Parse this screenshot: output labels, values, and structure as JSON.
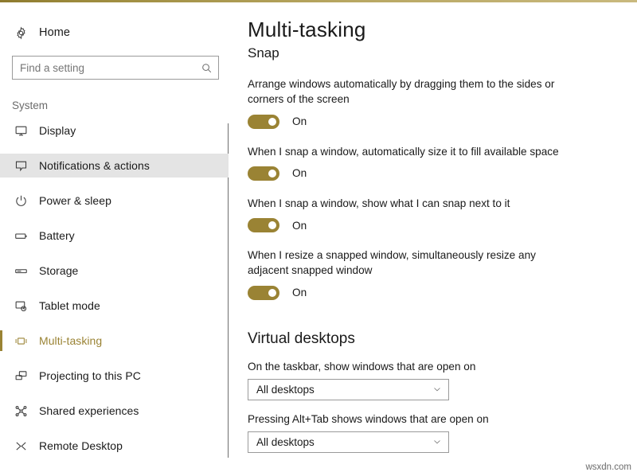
{
  "theme": {
    "accent": "#9a8334",
    "highlight": "#e4e4e4",
    "text": "#1a1a1a",
    "muted": "#6b6b6b"
  },
  "sidebar": {
    "home": {
      "label": "Home",
      "icon": "gear-icon"
    },
    "search": {
      "placeholder": "Find a setting",
      "value": "",
      "icon": "search-icon"
    },
    "section_label": "System",
    "items": [
      {
        "label": "Display",
        "icon": "monitor-icon",
        "state": "normal"
      },
      {
        "label": "Notifications & actions",
        "icon": "speech-bubble-icon",
        "state": "hovered"
      },
      {
        "label": "Power & sleep",
        "icon": "power-icon",
        "state": "normal"
      },
      {
        "label": "Battery",
        "icon": "battery-icon",
        "state": "normal"
      },
      {
        "label": "Storage",
        "icon": "storage-icon",
        "state": "normal"
      },
      {
        "label": "Tablet mode",
        "icon": "tablet-icon",
        "state": "normal"
      },
      {
        "label": "Multi-tasking",
        "icon": "multitask-icon",
        "state": "selected"
      },
      {
        "label": "Projecting to this PC",
        "icon": "project-icon",
        "state": "normal"
      },
      {
        "label": "Shared experiences",
        "icon": "share-icon",
        "state": "normal"
      },
      {
        "label": "Remote Desktop",
        "icon": "remote-desktop-icon",
        "state": "normal"
      }
    ]
  },
  "main": {
    "title": "Multi-tasking",
    "snap": {
      "heading": "Snap",
      "settings": [
        {
          "description": "Arrange windows automatically by dragging them to the sides or corners of the screen",
          "state": "On"
        },
        {
          "description": "When I snap a window, automatically size it to fill available space",
          "state": "On"
        },
        {
          "description": "When I snap a window, show what I can snap next to it",
          "state": "On"
        },
        {
          "description": "When I resize a snapped window, simultaneously resize any adjacent snapped window",
          "state": "On"
        }
      ]
    },
    "virtual_desktops": {
      "heading": "Virtual desktops",
      "options": [
        {
          "label": "On the taskbar, show windows that are open on",
          "value": "All desktops"
        },
        {
          "label": "Pressing Alt+Tab shows windows that are open on",
          "value": "All desktops"
        }
      ]
    }
  },
  "watermark": "wsxdn.com"
}
